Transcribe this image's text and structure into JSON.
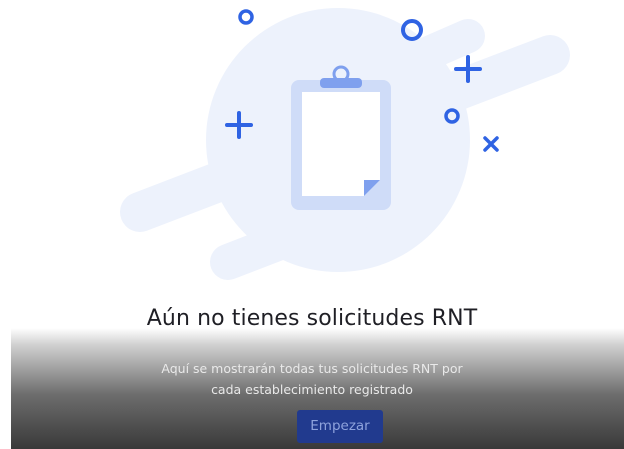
{
  "empty_state": {
    "title": "Aún no tienes solicitudes RNT",
    "description": "Aquí se mostrarán todas tus solicitudes RNT por cada establecimiento registrado",
    "start_button_label": "Empezar",
    "illustration_icon": "clipboard-icon"
  },
  "colors": {
    "accent": "#2f63e3",
    "blob": "#edf2fc",
    "clipboard": "#cfdcf8",
    "button": "#213a8e",
    "title": "#1f1f25"
  }
}
